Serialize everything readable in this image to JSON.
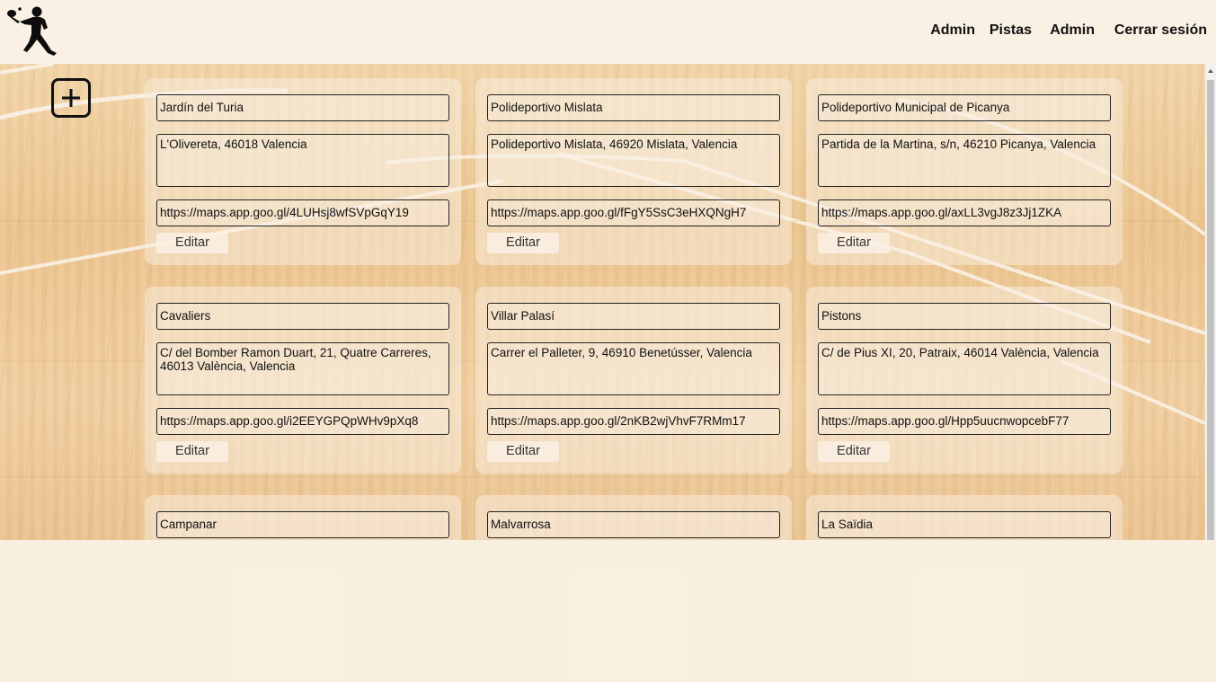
{
  "nav": {
    "items": [
      {
        "label": "Admin"
      },
      {
        "label": "Pistas"
      },
      {
        "label": "Admin"
      },
      {
        "label": "Cerrar sesión"
      }
    ]
  },
  "icons": {
    "logo": "padel-player-silhouette-icon",
    "add": "plus-icon"
  },
  "courts": [
    {
      "name": "Jardín del Turia",
      "address": "L'Olivereta, 46018 Valencia",
      "url": "https://maps.app.goo.gl/4LUHsj8wfSVpGqY19",
      "edit_label": "Editar"
    },
    {
      "name": "Polideportivo Mislata",
      "address": "Polideportivo Mislata, 46920 Mislata, Valencia",
      "url": "https://maps.app.goo.gl/fFgY5SsC3eHXQNgH7",
      "edit_label": "Editar"
    },
    {
      "name": "Polideportivo Municipal de Picanya",
      "address": "Partida de la Martina, s/n, 46210 Picanya, Valencia",
      "url": "https://maps.app.goo.gl/axLL3vgJ8z3Jj1ZKA",
      "edit_label": "Editar"
    },
    {
      "name": "Cavaliers",
      "address": "C/ del Bomber Ramon Duart, 21, Quatre Carreres, 46013 València, Valencia",
      "url": "https://maps.app.goo.gl/i2EEYGPQpWHv9pXq8",
      "edit_label": "Editar"
    },
    {
      "name": "Villar Palasí",
      "address": "Carrer el Palleter, 9, 46910 Benetússer, Valencia",
      "url": "https://maps.app.goo.gl/2nKB2wjVhvF7RMm17",
      "edit_label": "Editar"
    },
    {
      "name": "Pistons",
      "address": "C/ de Pius XI, 20, Patraix, 46014 València, Valencia",
      "url": "https://maps.app.goo.gl/Hpp5uucnwopcebF77",
      "edit_label": "Editar"
    },
    {
      "name": "Campanar",
      "address": "",
      "url": "",
      "edit_label": ""
    },
    {
      "name": "Malvarrosa",
      "address": "",
      "url": "",
      "edit_label": ""
    },
    {
      "name": "La Saïdia",
      "address": "",
      "url": "",
      "edit_label": ""
    }
  ]
}
